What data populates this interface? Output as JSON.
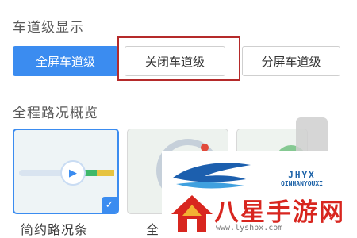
{
  "lane_display": {
    "title": "车道级显示",
    "options": [
      "全屏车道级",
      "关闭车道级",
      "分屏车道级"
    ],
    "selected": "全屏车道级"
  },
  "route_overview": {
    "title": "全程路况概览",
    "options": [
      "简约路况条",
      "全"
    ]
  },
  "watermark": {
    "brand": "QINHANYOUXI",
    "brand_short": "JHYX",
    "title": "八星手游网",
    "url": "www.lyshbx.com"
  },
  "colors": {
    "accent": "#3b8cf0",
    "highlight": "#b52a2a",
    "watermark_red": "#d8261f"
  }
}
